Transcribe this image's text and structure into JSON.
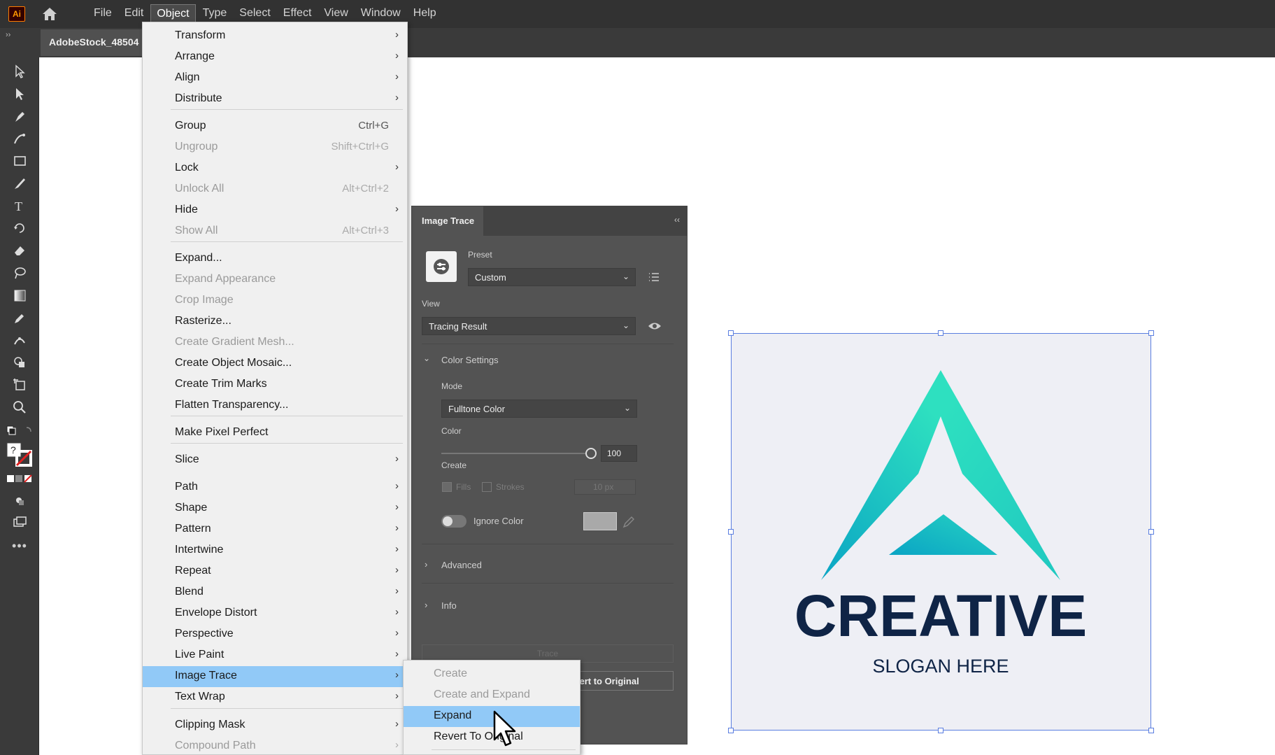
{
  "app": {
    "logo": "Ai",
    "document_tab": "AdobeStock_48504"
  },
  "menubar": {
    "items": [
      "File",
      "Edit",
      "Object",
      "Type",
      "Select",
      "Effect",
      "View",
      "Window",
      "Help"
    ],
    "active": "Object"
  },
  "object_menu": {
    "items": [
      {
        "label": "Transform",
        "shortcut": "",
        "submenu": true,
        "enabled": true
      },
      {
        "label": "Arrange",
        "shortcut": "",
        "submenu": true,
        "enabled": true
      },
      {
        "label": "Align",
        "shortcut": "",
        "submenu": true,
        "enabled": true
      },
      {
        "label": "Distribute",
        "shortcut": "",
        "submenu": true,
        "enabled": true
      },
      {
        "label": "Group",
        "shortcut": "Ctrl+G",
        "submenu": false,
        "enabled": true
      },
      {
        "label": "Ungroup",
        "shortcut": "Shift+Ctrl+G",
        "submenu": false,
        "enabled": false
      },
      {
        "label": "Lock",
        "shortcut": "",
        "submenu": true,
        "enabled": true
      },
      {
        "label": "Unlock All",
        "shortcut": "Alt+Ctrl+2",
        "submenu": false,
        "enabled": false
      },
      {
        "label": "Hide",
        "shortcut": "",
        "submenu": true,
        "enabled": true
      },
      {
        "label": "Show All",
        "shortcut": "Alt+Ctrl+3",
        "submenu": false,
        "enabled": false
      },
      {
        "label": "Expand...",
        "shortcut": "",
        "submenu": false,
        "enabled": true
      },
      {
        "label": "Expand Appearance",
        "shortcut": "",
        "submenu": false,
        "enabled": false
      },
      {
        "label": "Crop Image",
        "shortcut": "",
        "submenu": false,
        "enabled": false
      },
      {
        "label": "Rasterize...",
        "shortcut": "",
        "submenu": false,
        "enabled": true
      },
      {
        "label": "Create Gradient Mesh...",
        "shortcut": "",
        "submenu": false,
        "enabled": false
      },
      {
        "label": "Create Object Mosaic...",
        "shortcut": "",
        "submenu": false,
        "enabled": true
      },
      {
        "label": "Create Trim Marks",
        "shortcut": "",
        "submenu": false,
        "enabled": true
      },
      {
        "label": "Flatten Transparency...",
        "shortcut": "",
        "submenu": false,
        "enabled": true
      },
      {
        "label": "Make Pixel Perfect",
        "shortcut": "",
        "submenu": false,
        "enabled": true
      },
      {
        "label": "Slice",
        "shortcut": "",
        "submenu": true,
        "enabled": true
      },
      {
        "label": "Path",
        "shortcut": "",
        "submenu": true,
        "enabled": true
      },
      {
        "label": "Shape",
        "shortcut": "",
        "submenu": true,
        "enabled": true
      },
      {
        "label": "Pattern",
        "shortcut": "",
        "submenu": true,
        "enabled": true
      },
      {
        "label": "Intertwine",
        "shortcut": "",
        "submenu": true,
        "enabled": true
      },
      {
        "label": "Repeat",
        "shortcut": "",
        "submenu": true,
        "enabled": true
      },
      {
        "label": "Blend",
        "shortcut": "",
        "submenu": true,
        "enabled": true
      },
      {
        "label": "Envelope Distort",
        "shortcut": "",
        "submenu": true,
        "enabled": true
      },
      {
        "label": "Perspective",
        "shortcut": "",
        "submenu": true,
        "enabled": true
      },
      {
        "label": "Live Paint",
        "shortcut": "",
        "submenu": true,
        "enabled": true
      },
      {
        "label": "Image Trace",
        "shortcut": "",
        "submenu": true,
        "enabled": true,
        "highlighted": true
      },
      {
        "label": "Text Wrap",
        "shortcut": "",
        "submenu": true,
        "enabled": true
      },
      {
        "label": "Clipping Mask",
        "shortcut": "",
        "submenu": true,
        "enabled": true
      },
      {
        "label": "Compound Path",
        "shortcut": "",
        "submenu": true,
        "enabled": false
      }
    ]
  },
  "image_trace_submenu": {
    "items": [
      {
        "label": "Create",
        "enabled": false
      },
      {
        "label": "Create and Expand",
        "enabled": false
      },
      {
        "label": "Expand",
        "enabled": true,
        "highlighted": true
      },
      {
        "label": "Revert To Original",
        "enabled": true
      }
    ]
  },
  "image_trace_panel": {
    "tab": "Image Trace",
    "preset_label": "Preset",
    "preset_value": "Custom",
    "view_label": "View",
    "view_value": "Tracing Result",
    "color_settings_label": "Color Settings",
    "mode_label": "Mode",
    "mode_value": "Fulltone Color",
    "color_label": "Color",
    "color_value": "100",
    "color_fraction": 1.0,
    "create_label": "Create",
    "fills_label": "Fills",
    "strokes_label": "Strokes",
    "stroke_value": "10 px",
    "ignore_color_label": "Ignore Color",
    "advanced_label": "Advanced",
    "info_label": "Info",
    "trace_button": "Trace",
    "revert_button": "evert to Original"
  },
  "artwork": {
    "title": "CREATIVE",
    "slogan": "SLOGAN HERE",
    "colors": {
      "teal_light": "#2ee0c0",
      "teal_dark": "#0aa4c4",
      "navy": "#0f2446"
    }
  },
  "colors": {
    "highlight": "#91c9f7",
    "selection": "#5a7ee0"
  }
}
